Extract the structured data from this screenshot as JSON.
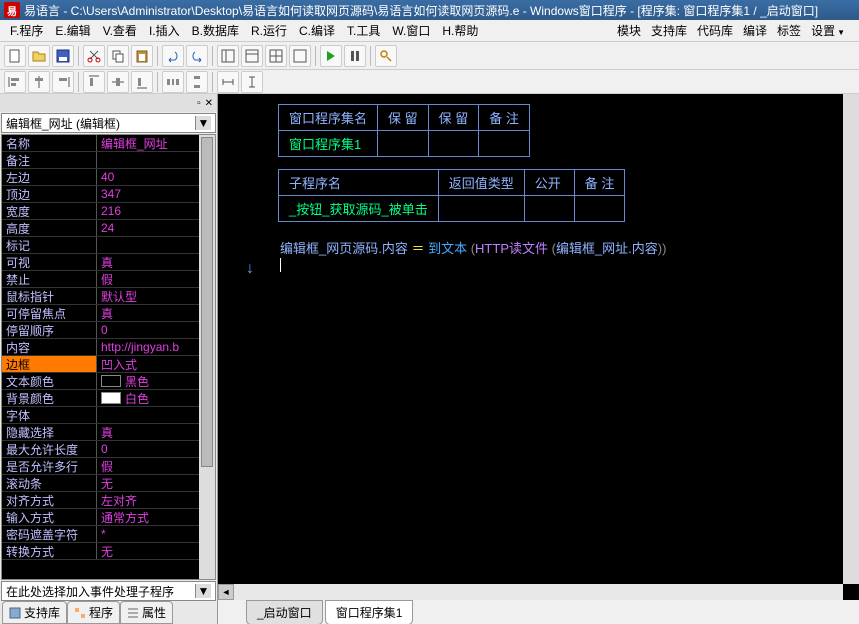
{
  "title": "易语言 - C:\\Users\\Administrator\\Desktop\\易语言如何读取网页源码\\易语言如何读取网页源码.e - Windows窗口程序 - [程序集: 窗口程序集1 / _启动窗口]",
  "menu": {
    "items": [
      "F.程序",
      "E.编辑",
      "V.查看",
      "I.插入",
      "B.数据库",
      "R.运行",
      "C.编译",
      "T.工具",
      "W.窗口",
      "H.帮助"
    ],
    "right": [
      "模块",
      "支持库",
      "代码库",
      "编译",
      "标签",
      "设置"
    ]
  },
  "left": {
    "dropdown": "编辑框_网址 (编辑框)",
    "event_dd": "在此处选择加入事件处理子程序",
    "tabs": [
      "支持库",
      "程序",
      "属性"
    ],
    "props": [
      {
        "k": "名称",
        "v": "编辑框_网址"
      },
      {
        "k": "备注",
        "v": ""
      },
      {
        "k": "左边",
        "v": "40"
      },
      {
        "k": "顶边",
        "v": "347"
      },
      {
        "k": "宽度",
        "v": "216"
      },
      {
        "k": "高度",
        "v": "24"
      },
      {
        "k": "标记",
        "v": ""
      },
      {
        "k": "可视",
        "v": "真"
      },
      {
        "k": "禁止",
        "v": "假"
      },
      {
        "k": "鼠标指针",
        "v": "默认型"
      },
      {
        "k": "可停留焦点",
        "v": "真"
      },
      {
        "k": "  停留顺序",
        "v": "0"
      },
      {
        "k": "内容",
        "v": "http://jingyan.b"
      },
      {
        "k": "边框",
        "v": "凹入式",
        "sel": true
      },
      {
        "k": "文本颜色",
        "v": "黑色",
        "sw": "#000000"
      },
      {
        "k": "背景颜色",
        "v": "白色",
        "sw": "#ffffff"
      },
      {
        "k": "字体",
        "v": ""
      },
      {
        "k": "隐藏选择",
        "v": "真"
      },
      {
        "k": "最大允许长度",
        "v": "0"
      },
      {
        "k": "是否允许多行",
        "v": "假"
      },
      {
        "k": "滚动条",
        "v": "无"
      },
      {
        "k": "对齐方式",
        "v": "左对齐"
      },
      {
        "k": "输入方式",
        "v": "通常方式"
      },
      {
        "k": "  密码遮盖字符",
        "v": "*"
      },
      {
        "k": "转换方式",
        "v": "无"
      }
    ]
  },
  "code": {
    "table1_headers": [
      "窗口程序集名",
      "保 留",
      "保 留",
      "备 注"
    ],
    "table1_row": "窗口程序集1",
    "table2_headers": [
      "子程序名",
      "返回值类型",
      "公开",
      "备 注"
    ],
    "table2_row": "_按钮_获取源码_被单击",
    "line_parts": {
      "p1": "编辑框_网页源码.内容",
      "op": " ＝ ",
      "p2": "到文本",
      "sp": " (",
      "p3": "HTTP读文件",
      "sp2": " (",
      "p4": "编辑框_网址.内容",
      "p5": "))"
    },
    "tabs": [
      "_启动窗口",
      "窗口程序集1"
    ]
  }
}
